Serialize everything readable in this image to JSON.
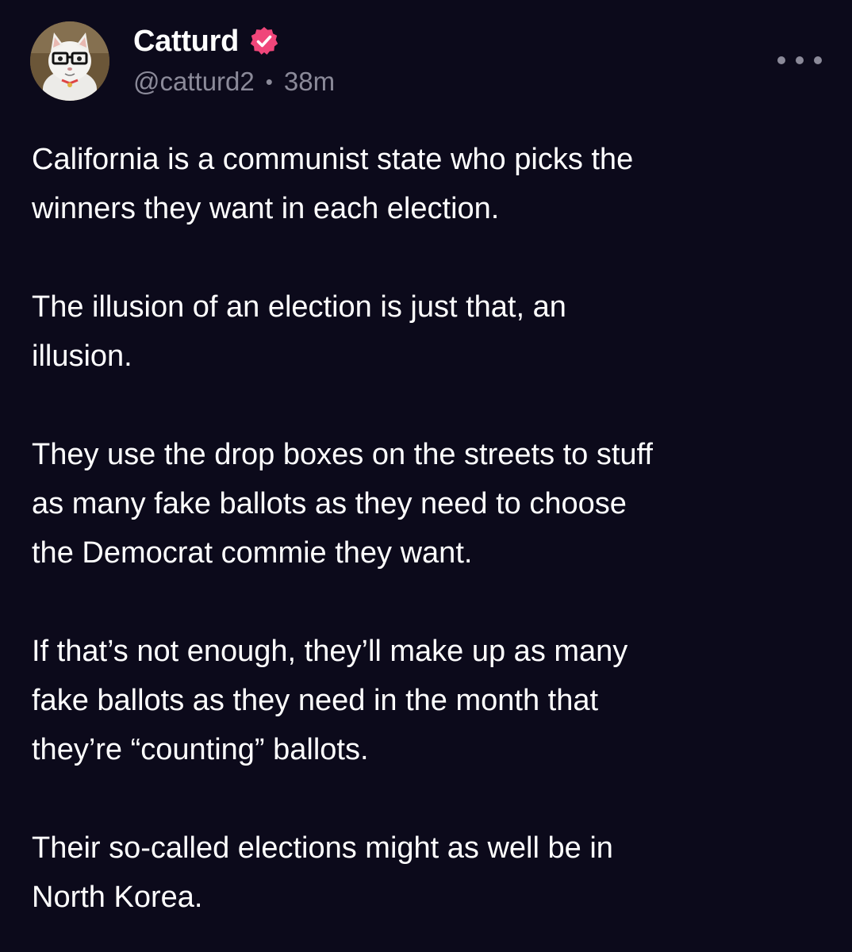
{
  "author": {
    "display_name": "Catturd",
    "handle": "@catturd2",
    "separator": "•",
    "time_ago": "38m",
    "verified": true,
    "verified_color": "#f0467a",
    "avatar_icon": "cat-with-glasses-avatar"
  },
  "post": {
    "paragraphs": [
      "California is a communist state who picks the\nwinners they want in each election.",
      "The illusion of an election is just that, an\nillusion.",
      "They use the drop boxes on the streets to stuff\nas many fake ballots as they need to choose\nthe Democrat commie they want.",
      "If that’s not enough, they’ll make up as many\nfake ballots as they need in the month that\nthey’re “counting” ballots.",
      "Their so-called elections might as well be in\nNorth Korea."
    ]
  },
  "more_menu_icon": "more-horizontal-icon",
  "colors": {
    "background": "#0c0a1b",
    "text": "#ffffff",
    "muted": "#8b8a99"
  }
}
